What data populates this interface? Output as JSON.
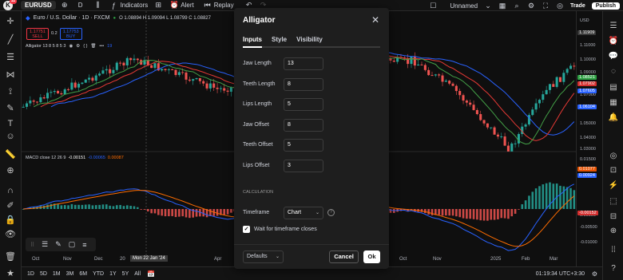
{
  "topbar": {
    "logo_letter": "K",
    "notification_count": "11",
    "symbol": "EURUSD",
    "interval": "D",
    "indicators_label": "Indicators",
    "alert_label": "Alert",
    "replay_label": "Replay",
    "layout_name": "Unnamed",
    "trade_label": "Trade",
    "publish_label": "Publish"
  },
  "chart": {
    "title": "Euro / U.S. Dollar · 1D · FXCM",
    "ohlc": "O 1.08894 H 1.09094 L 1.08799 C 1.08827",
    "sell_price": "1.17751",
    "sell_label": "SELL",
    "spread": "0.2",
    "buy_price": "1.17753",
    "buy_label": "BUY",
    "indicator_legend": "Alligator 13 8 5 8 5 3",
    "indicator_value": "19",
    "macd_legend": "MACD close 12 26 9",
    "macd_v1": "-0.00151",
    "macd_v2": "-0.00065",
    "macd_v3": "0.00087",
    "currency": "USD",
    "crosshair_date": "Mon 22 Jan '24",
    "x_labels": [
      "Oct",
      "Nov",
      "Dec",
      "20",
      "Apr",
      "Oct",
      "Nov",
      "2025",
      "Feb",
      "Mar"
    ],
    "price_labels": [
      "1.11000",
      "1.10000",
      "1.09000",
      "1.07000",
      "1.05000",
      "1.04000",
      "1.03000"
    ],
    "price_tags": [
      {
        "value": "1.11909",
        "color": "#3a3a3a"
      },
      {
        "value": "1.08521",
        "color": "#2ea043"
      },
      {
        "value": "1.07902",
        "color": "#d32f2f"
      },
      {
        "value": "1.07605",
        "color": "#2962ff"
      },
      {
        "value": "1.06104",
        "color": "#2962ff"
      }
    ],
    "macd_labels": [
      "0.01500",
      "0.00500",
      "-0.00500",
      "-0.01000"
    ],
    "macd_tags": [
      {
        "value": "0.01077",
        "color": "#e65100"
      },
      {
        "value": "0.00924",
        "color": "#2962ff"
      },
      {
        "value": "-0.00152",
        "color": "#d32f2f"
      }
    ]
  },
  "bottombar": {
    "ranges": [
      "1D",
      "5D",
      "1M",
      "3M",
      "6M",
      "YTD",
      "1Y",
      "5Y",
      "All"
    ],
    "clock": "01:19:34 UTC+3:30"
  },
  "dialog": {
    "title": "Alligator",
    "tabs": [
      "Inputs",
      "Style",
      "Visibility"
    ],
    "fields": [
      {
        "label": "Jaw Length",
        "value": "13"
      },
      {
        "label": "Teeth Length",
        "value": "8"
      },
      {
        "label": "Lips Length",
        "value": "5"
      },
      {
        "label": "Jaw Offset",
        "value": "8"
      },
      {
        "label": "Teeth Offset",
        "value": "5"
      },
      {
        "label": "Lips Offset",
        "value": "3"
      }
    ],
    "section_label": "CALCULATION",
    "timeframe_label": "Timeframe",
    "timeframe_value": "Chart",
    "wait_label": "Wait for timeframe closes",
    "defaults_label": "Defaults",
    "cancel_label": "Cancel",
    "ok_label": "Ok"
  }
}
